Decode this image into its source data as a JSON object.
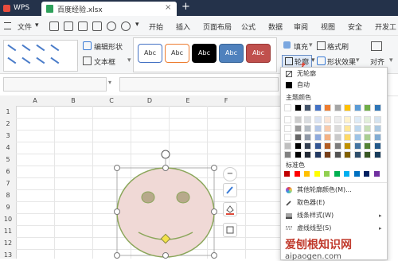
{
  "titlebar": {
    "app": "WPS",
    "doc_title": "百度经验.xlsx",
    "close": "×",
    "new_tab": "+"
  },
  "menu": {
    "file": "文件",
    "file_arrow": "▾",
    "items": [
      "开始",
      "插入",
      "页面布局",
      "公式",
      "数据",
      "审阅",
      "视图",
      "安全",
      "开发工"
    ]
  },
  "ribbon": {
    "edit_shape": "编辑形状",
    "text_box": "文本框",
    "styles": [
      {
        "label": "Abc",
        "fill": "#ffffff",
        "border": "#4472c4",
        "text": "#333333"
      },
      {
        "label": "Abc",
        "fill": "#ffffff",
        "border": "#ed7d31",
        "text": "#333333"
      },
      {
        "label": "Abc",
        "fill": "#000000",
        "border": "#000000",
        "text": "#ffffff"
      },
      {
        "label": "Abc",
        "fill": "#4f81bd",
        "border": "#3a6699",
        "text": "#ffffff"
      },
      {
        "label": "Abc",
        "fill": "#c0504d",
        "border": "#9b3a37",
        "text": "#ffffff"
      }
    ],
    "fill": "填充",
    "format_painter": "格式刷",
    "outline": "轮廓",
    "shape_effect": "形状效果",
    "align": "对齐"
  },
  "columns": [
    "A",
    "B",
    "C",
    "D",
    "E",
    "F"
  ],
  "rows": [
    "1",
    "2",
    "3",
    "4",
    "5",
    "6",
    "7",
    "8",
    "9",
    "10",
    "11",
    "12",
    "13"
  ],
  "dropdown": {
    "no_outline": "无轮廓",
    "auto": "自动",
    "theme_colors_title": "主题颜色",
    "theme_top": [
      "#ffffff",
      "#000000",
      "#44546a",
      "#4472c4",
      "#ed7d31",
      "#a5a5a5",
      "#ffc000",
      "#5b9bd5",
      "#70ad47",
      "#2e75b6"
    ],
    "standard_title": "标准色",
    "standard": [
      "#c00000",
      "#ff0000",
      "#ffc000",
      "#ffff00",
      "#92d050",
      "#00b050",
      "#00b0f0",
      "#0070c0",
      "#002060",
      "#7030a0"
    ],
    "more_colors": "其他轮廓颜色(M)...",
    "picker": "取色器(E)",
    "line_style": "线条样式(W)",
    "dash_style": "虚线线型(S)"
  },
  "watermark": {
    "main": "爱刨根知识网",
    "sub": "aipaogen.com"
  },
  "colors": {
    "titlebar": "#24324a",
    "face_fill": "#f0d9d6",
    "face_stroke": "#8aa65a",
    "accent_red": "#e04b3b"
  }
}
